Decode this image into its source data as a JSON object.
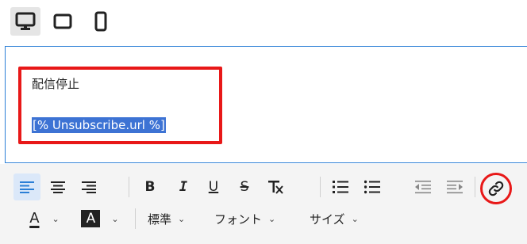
{
  "device_bar": {
    "items": [
      {
        "icon": "desktop-icon",
        "active": true
      },
      {
        "icon": "tablet-icon",
        "active": false
      },
      {
        "icon": "mobile-icon",
        "active": false
      }
    ]
  },
  "editor": {
    "line1": "配信停止",
    "line2": "[% Unsubscribe.url %]"
  },
  "toolbar": {
    "row1": [
      "align-left-icon",
      "align-center-icon",
      "align-right-icon",
      "bold-icon",
      "italic-icon",
      "underline-icon",
      "strikethrough-icon",
      "clear-format-icon",
      "ordered-list-icon",
      "bullet-list-icon",
      "outdent-icon",
      "indent-icon",
      "link-icon"
    ],
    "bold_label": "B",
    "italic_label": "I",
    "underline_label": "U",
    "strike_label": "S",
    "text_color_label": "A",
    "bg_color_label": "A",
    "format_label": "標準",
    "font_label": "フォント",
    "size_label": "サイズ"
  },
  "colors": {
    "accent": "#2b7fd6",
    "highlight_red": "#e81818",
    "selection": "#3d73d4"
  }
}
